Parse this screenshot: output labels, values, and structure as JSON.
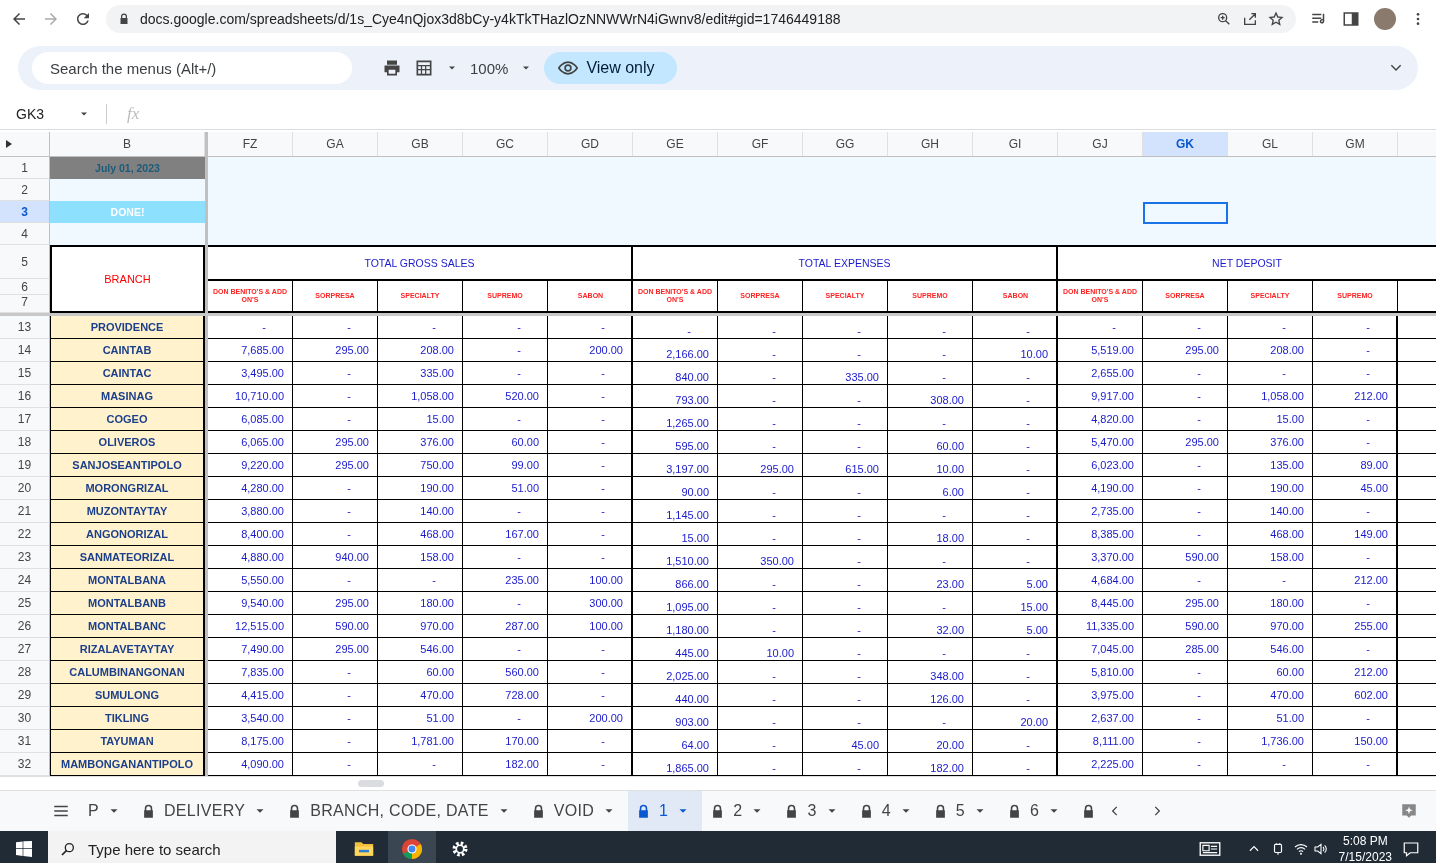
{
  "browser": {
    "url": "docs.google.com/spreadsheets/d/1s_Cye4nQjox3d8bCy-y4kTkTHazlOzNNWWrN4iGwnv8/edit#gid=1746449188"
  },
  "toolbar": {
    "search_placeholder": "Search the menus (Alt+/)",
    "zoom": "100%",
    "view_mode": "View only"
  },
  "formula_bar": {
    "cell_ref": "GK3",
    "fx": "fx"
  },
  "columns": [
    {
      "label": "B",
      "selected": false
    },
    {
      "label": "FZ",
      "selected": false
    },
    {
      "label": "GA",
      "selected": false
    },
    {
      "label": "GB",
      "selected": false
    },
    {
      "label": "GC",
      "selected": false
    },
    {
      "label": "GD",
      "selected": false
    },
    {
      "label": "GE",
      "selected": false
    },
    {
      "label": "GF",
      "selected": false
    },
    {
      "label": "GG",
      "selected": false
    },
    {
      "label": "GH",
      "selected": false
    },
    {
      "label": "GI",
      "selected": false
    },
    {
      "label": "GJ",
      "selected": false
    },
    {
      "label": "GK",
      "selected": true
    },
    {
      "label": "GL",
      "selected": false
    },
    {
      "label": "GM",
      "selected": false
    }
  ],
  "frozen_rows": [
    {
      "label": "1",
      "selected": false
    },
    {
      "label": "2",
      "selected": false
    },
    {
      "label": "3",
      "selected": true
    },
    {
      "label": "4",
      "selected": false
    },
    {
      "label": "5",
      "selected": false
    },
    {
      "label": "6",
      "selected": false
    },
    {
      "label": "7",
      "selected": false
    }
  ],
  "date": "July 01, 2023",
  "status": "DONE!",
  "branch_header": "BRANCH",
  "groups": [
    {
      "title": "TOTAL GROSS SALES",
      "subheaders": [
        "DON BENITO'S & ADD ON'S",
        "SORPRESA",
        "SPECIALTY",
        "SUPREMO",
        "SABON"
      ]
    },
    {
      "title": "TOTAL EXPENSES",
      "subheaders": [
        "DON BENITO'S & ADD ON'S",
        "SORPRESA",
        "SPECIALTY",
        "SUPREMO",
        "SABON"
      ]
    },
    {
      "title": "NET DEPOSIT",
      "subheaders": [
        "DON BENITO'S & ADD ON'S",
        "SORPRESA",
        "SPECIALTY",
        "SUPREMO"
      ]
    }
  ],
  "rows": [
    {
      "row": "13",
      "branch": "PROVIDENCE",
      "values": [
        "-",
        "-",
        "-",
        "-",
        "-",
        "-",
        "-",
        "-",
        "-",
        "-",
        "-",
        "-",
        "-",
        "-"
      ]
    },
    {
      "row": "14",
      "branch": "CAINTAB",
      "values": [
        "7,685.00",
        "295.00",
        "208.00",
        "-",
        "200.00",
        "2,166.00",
        "-",
        "-",
        "-",
        "10.00",
        "5,519.00",
        "295.00",
        "208.00",
        "-"
      ]
    },
    {
      "row": "15",
      "branch": "CAINTAC",
      "values": [
        "3,495.00",
        "-",
        "335.00",
        "-",
        "-",
        "840.00",
        "-",
        "335.00",
        "-",
        "-",
        "2,655.00",
        "-",
        "-",
        "-"
      ]
    },
    {
      "row": "16",
      "branch": "MASINAG",
      "values": [
        "10,710.00",
        "-",
        "1,058.00",
        "520.00",
        "-",
        "793.00",
        "-",
        "-",
        "308.00",
        "-",
        "9,917.00",
        "-",
        "1,058.00",
        "212.00"
      ]
    },
    {
      "row": "17",
      "branch": "COGEO",
      "values": [
        "6,085.00",
        "-",
        "15.00",
        "-",
        "-",
        "1,265.00",
        "-",
        "-",
        "-",
        "-",
        "4,820.00",
        "-",
        "15.00",
        "-"
      ]
    },
    {
      "row": "18",
      "branch": "OLIVEROS",
      "values": [
        "6,065.00",
        "295.00",
        "376.00",
        "60.00",
        "-",
        "595.00",
        "-",
        "-",
        "60.00",
        "-",
        "5,470.00",
        "295.00",
        "376.00",
        "-"
      ]
    },
    {
      "row": "19",
      "branch": "SANJOSEANTIPOLO",
      "values": [
        "9,220.00",
        "295.00",
        "750.00",
        "99.00",
        "-",
        "3,197.00",
        "295.00",
        "615.00",
        "10.00",
        "-",
        "6,023.00",
        "-",
        "135.00",
        "89.00"
      ]
    },
    {
      "row": "20",
      "branch": "MORONGRIZAL",
      "values": [
        "4,280.00",
        "-",
        "190.00",
        "51.00",
        "-",
        "90.00",
        "-",
        "-",
        "6.00",
        "-",
        "4,190.00",
        "-",
        "190.00",
        "45.00"
      ]
    },
    {
      "row": "21",
      "branch": "MUZONTAYTAY",
      "values": [
        "3,880.00",
        "-",
        "140.00",
        "-",
        "-",
        "1,145.00",
        "-",
        "-",
        "-",
        "-",
        "2,735.00",
        "-",
        "140.00",
        "-"
      ]
    },
    {
      "row": "22",
      "branch": "ANGONORIZAL",
      "values": [
        "8,400.00",
        "-",
        "468.00",
        "167.00",
        "-",
        "15.00",
        "-",
        "-",
        "18.00",
        "-",
        "8,385.00",
        "-",
        "468.00",
        "149.00"
      ]
    },
    {
      "row": "23",
      "branch": "SANMATEORIZAL",
      "values": [
        "4,880.00",
        "940.00",
        "158.00",
        "-",
        "-",
        "1,510.00",
        "350.00",
        "-",
        "-",
        "-",
        "3,370.00",
        "590.00",
        "158.00",
        "-"
      ]
    },
    {
      "row": "24",
      "branch": "MONTALBANA",
      "values": [
        "5,550.00",
        "-",
        "-",
        "235.00",
        "100.00",
        "866.00",
        "-",
        "-",
        "23.00",
        "5.00",
        "4,684.00",
        "-",
        "-",
        "212.00"
      ]
    },
    {
      "row": "25",
      "branch": "MONTALBANB",
      "values": [
        "9,540.00",
        "295.00",
        "180.00",
        "-",
        "300.00",
        "1,095.00",
        "-",
        "-",
        "-",
        "15.00",
        "8,445.00",
        "295.00",
        "180.00",
        "-"
      ]
    },
    {
      "row": "26",
      "branch": "MONTALBANC",
      "values": [
        "12,515.00",
        "590.00",
        "970.00",
        "287.00",
        "100.00",
        "1,180.00",
        "-",
        "-",
        "32.00",
        "5.00",
        "11,335.00",
        "590.00",
        "970.00",
        "255.00"
      ]
    },
    {
      "row": "27",
      "branch": "RIZALAVETAYTAY",
      "values": [
        "7,490.00",
        "295.00",
        "546.00",
        "-",
        "-",
        "445.00",
        "10.00",
        "-",
        "-",
        "-",
        "7,045.00",
        "285.00",
        "546.00",
        "-"
      ]
    },
    {
      "row": "28",
      "branch": "CALUMBINANGONAN",
      "values": [
        "7,835.00",
        "-",
        "60.00",
        "560.00",
        "-",
        "2,025.00",
        "-",
        "-",
        "348.00",
        "-",
        "5,810.00",
        "-",
        "60.00",
        "212.00"
      ]
    },
    {
      "row": "29",
      "branch": "SUMULONG",
      "values": [
        "4,415.00",
        "-",
        "470.00",
        "728.00",
        "-",
        "440.00",
        "-",
        "-",
        "126.00",
        "-",
        "3,975.00",
        "-",
        "470.00",
        "602.00"
      ]
    },
    {
      "row": "30",
      "branch": "TIKLING",
      "values": [
        "3,540.00",
        "-",
        "51.00",
        "-",
        "200.00",
        "903.00",
        "-",
        "-",
        "-",
        "20.00",
        "2,637.00",
        "-",
        "51.00",
        "-"
      ]
    },
    {
      "row": "31",
      "branch": "TAYUMAN",
      "values": [
        "8,175.00",
        "-",
        "1,781.00",
        "170.00",
        "-",
        "64.00",
        "-",
        "45.00",
        "20.00",
        "-",
        "8,111.00",
        "-",
        "1,736.00",
        "150.00"
      ]
    },
    {
      "row": "32",
      "branch": "MAMBONGANANTIPOLO",
      "values": [
        "4,090.00",
        "-",
        "-",
        "182.00",
        "-",
        "1,865.00",
        "-",
        "-",
        "182.00",
        "-",
        "2,225.00",
        "-",
        "-",
        "-"
      ]
    }
  ],
  "sheet_tabs": [
    {
      "label": "P",
      "locked": false,
      "selected": false
    },
    {
      "label": "DELIVERY",
      "locked": true,
      "selected": false
    },
    {
      "label": "BRANCH, CODE, DATE",
      "locked": true,
      "selected": false
    },
    {
      "label": "VOID",
      "locked": true,
      "selected": false
    },
    {
      "label": "1",
      "locked": true,
      "selected": true
    },
    {
      "label": "2",
      "locked": true,
      "selected": false
    },
    {
      "label": "3",
      "locked": true,
      "selected": false
    },
    {
      "label": "4",
      "locked": true,
      "selected": false
    },
    {
      "label": "5",
      "locked": true,
      "selected": false
    },
    {
      "label": "6",
      "locked": true,
      "selected": false
    },
    {
      "locked": true,
      "selected": false
    }
  ],
  "taskbar": {
    "search_placeholder": "Type here to search",
    "time": "5:08 PM",
    "date": "7/15/2023"
  }
}
